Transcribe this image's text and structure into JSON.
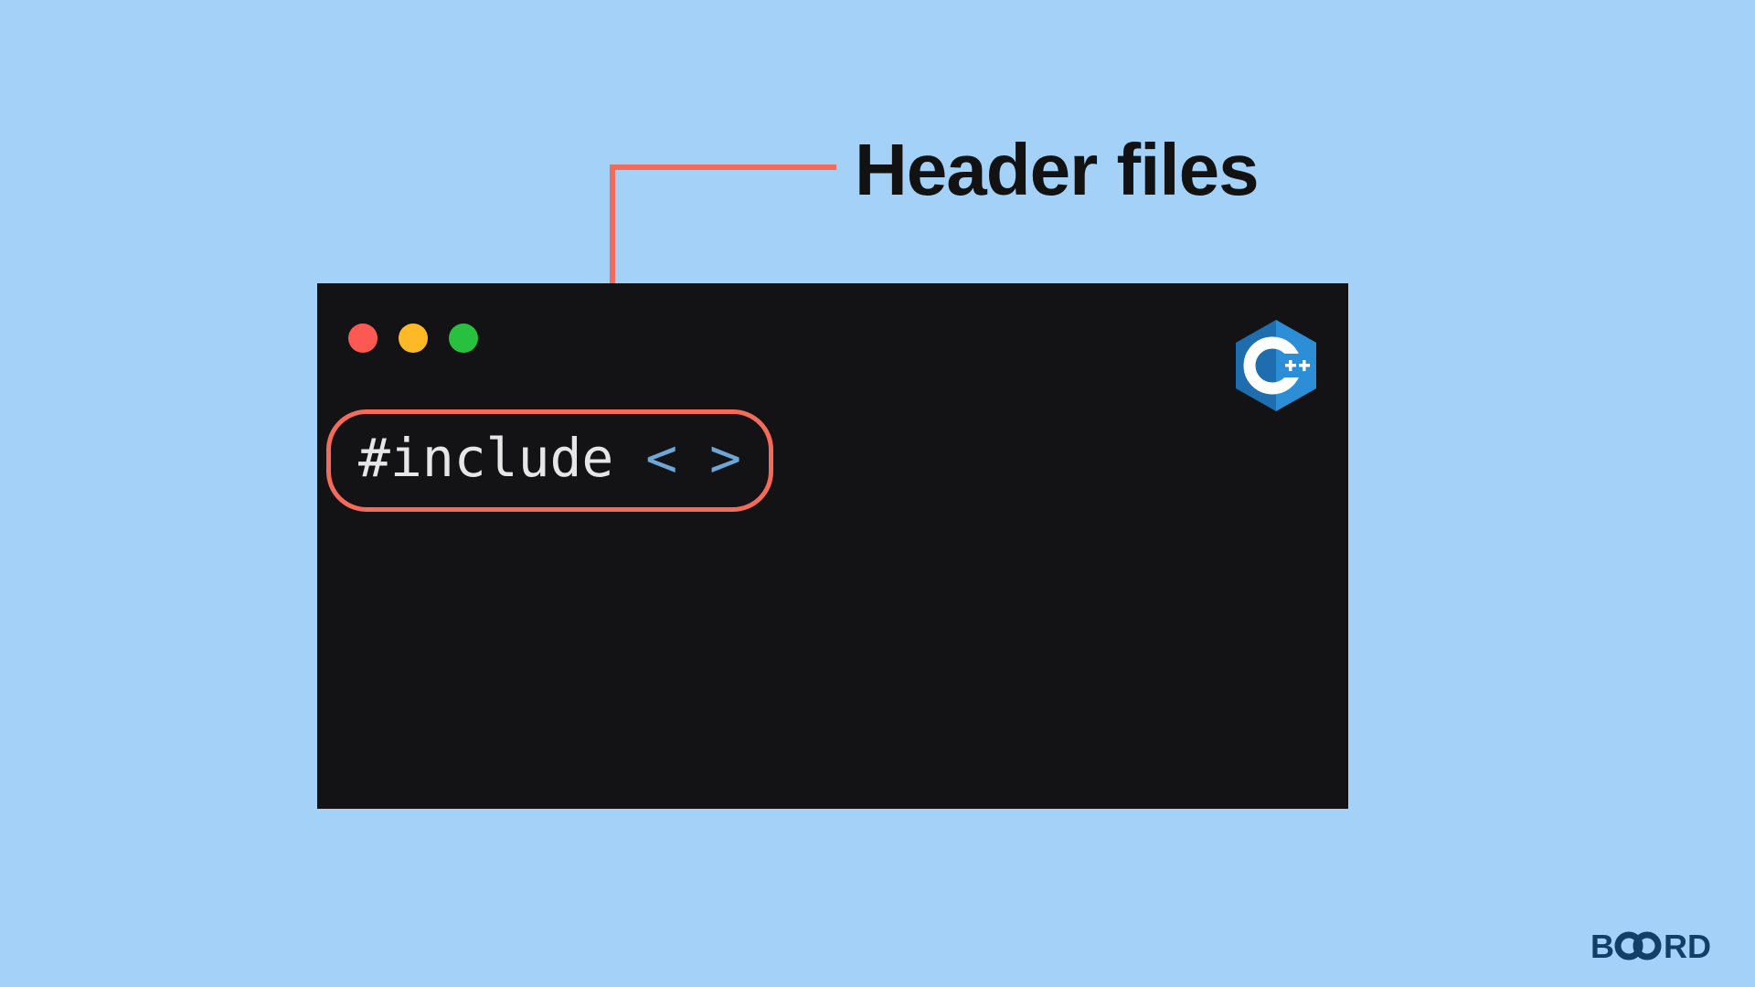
{
  "title": "Header files",
  "code": {
    "directive": "#include",
    "angles": "< >"
  },
  "colors": {
    "bg": "#A3D1F7",
    "terminal": "#131316",
    "accent": "#F56B5B",
    "dot_red": "#FD5953",
    "dot_yellow": "#FEB927",
    "dot_green": "#27C13F",
    "code_white": "#E6E6E6",
    "code_blue": "#6CA7D8",
    "brand": "#113F67",
    "cpp_hex_dark": "#1D6DAF",
    "cpp_hex_mid": "#2B8ED6",
    "cpp_letter": "#FFFFFF"
  },
  "icons": {
    "close": "close-icon",
    "minimize": "minimize-icon",
    "zoom": "zoom-icon",
    "cpp": "cpp-logo-icon",
    "brand": "board-logo"
  },
  "brand_text": {
    "b": "B",
    "rd": "RD"
  }
}
